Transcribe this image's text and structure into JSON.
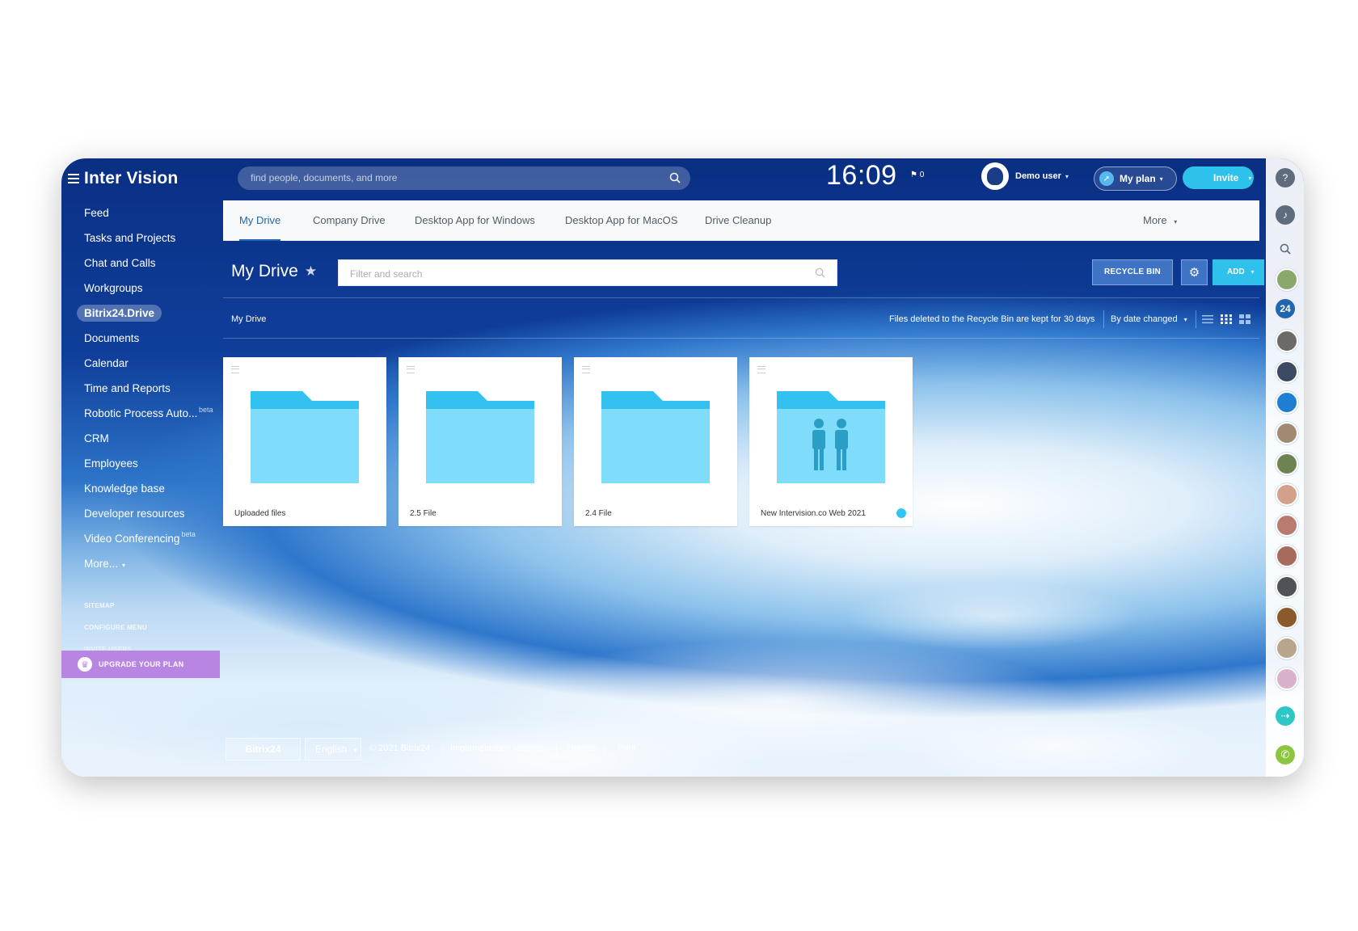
{
  "app": {
    "logo_text": "Inter Vision"
  },
  "sidebar": {
    "items": [
      {
        "label": "Feed"
      },
      {
        "label": "Tasks and Projects"
      },
      {
        "label": "Chat and Calls"
      },
      {
        "label": "Workgroups"
      },
      {
        "label": "Bitrix24.Drive"
      },
      {
        "label": "Documents"
      },
      {
        "label": "Calendar"
      },
      {
        "label": "Time and Reports"
      },
      {
        "label": "Robotic Process Auto..."
      },
      {
        "label": "CRM"
      },
      {
        "label": "Employees"
      },
      {
        "label": "Knowledge base"
      },
      {
        "label": "Developer resources"
      },
      {
        "label": "Video Conferencing"
      },
      {
        "label": "More..."
      }
    ],
    "beta_label": "beta",
    "active_index": 4,
    "sitemap": "SITEMAP",
    "configure": "CONFIGURE MENU",
    "invite_users": "INVITE USERS",
    "upgrade": "UPGRADE YOUR PLAN"
  },
  "header": {
    "search_placeholder": "find people, documents, and more",
    "clock": "16:09",
    "flag_count": "0",
    "user_name": "Demo user",
    "plan_label": "My plan",
    "invite_label": "Invite"
  },
  "tabs": [
    {
      "label": "My Drive"
    },
    {
      "label": "Company Drive"
    },
    {
      "label": "Desktop App for Windows"
    },
    {
      "label": "Desktop App for MacOS"
    },
    {
      "label": "Drive Cleanup"
    }
  ],
  "tabs_more": "More",
  "toolbar": {
    "title": "My Drive",
    "filter_placeholder": "Filter and search",
    "recycle_bin": "RECYCLE BIN",
    "add": "ADD"
  },
  "listbar": {
    "breadcrumb": "My Drive",
    "info": "Files deleted to the Recycle Bin are kept for 30 days",
    "sort": "By date changed"
  },
  "folders": [
    {
      "name": "Uploaded files",
      "shared": false
    },
    {
      "name": "2.5 File",
      "shared": false
    },
    {
      "name": "2.4 File",
      "shared": false
    },
    {
      "name": "New Intervision.co Web 2021",
      "shared": true
    }
  ],
  "footer": {
    "brand": "Bitrix24",
    "language": "English",
    "copyright": "© 2021 Bitrix24",
    "implementation": "Implementation request",
    "themes": "Themes",
    "print": "Print"
  },
  "colors": {
    "accent": "#2ec1eb",
    "tab_active": "#2067b0",
    "folder": "#7fdcfa",
    "folder_tab": "#33c1f0",
    "upgrade": "#b985e2"
  },
  "right_strip": {
    "counter": "24"
  }
}
